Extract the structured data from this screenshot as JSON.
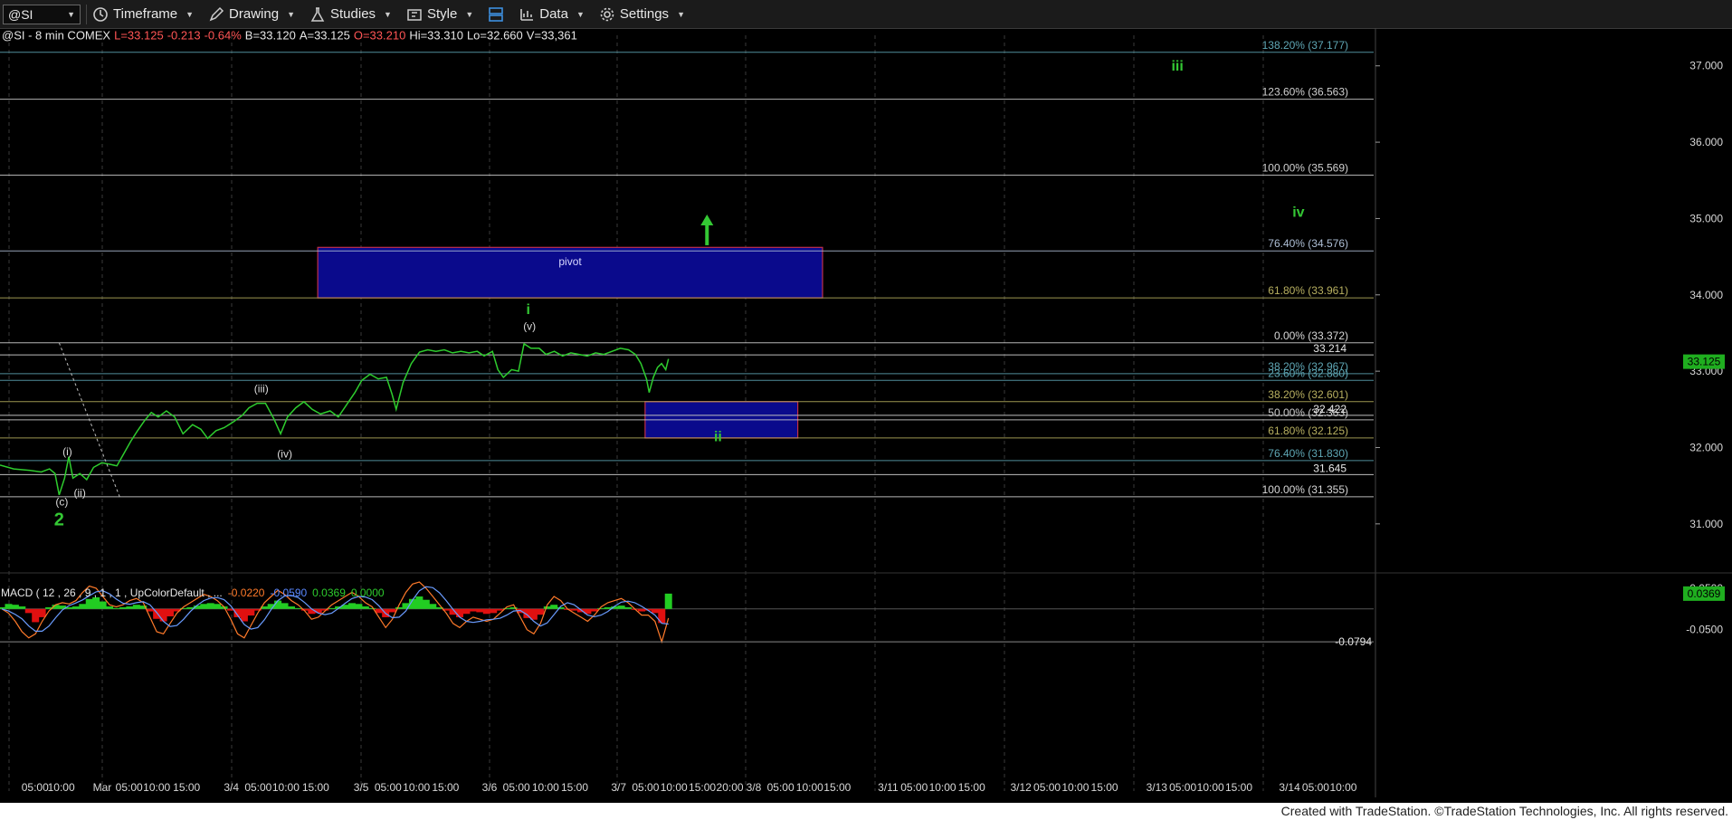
{
  "toolbar": {
    "symbol": "@SI",
    "timeframe": "Timeframe",
    "drawing": "Drawing",
    "studies": "Studies",
    "style": "Style",
    "data": "Data",
    "settings": "Settings"
  },
  "header": {
    "symbol_info": "@SI - 8 min  COMEX",
    "last": "L=33.125",
    "change": "-0.213",
    "change_pct": "-0.64%",
    "bid": "B=33.120",
    "ask": "A=33.125",
    "open": "O=33.210",
    "high": "Hi=33.310",
    "low": "Lo=32.660",
    "volume": "V=33,361"
  },
  "macd": {
    "label": "MACD ( 12 , 26 , 9 , 1 , 1 , UpColorDefault , ...",
    "v1": "-0.0220",
    "v2": "-0.0590",
    "v3": "0.0369",
    "v4": "0.0000",
    "axis_labels": [
      "0.0500",
      "-0.0500"
    ],
    "current_tag": "0.0369",
    "min_tag": "-0.0794"
  },
  "footer": "Created with TradeStation. ©TradeStation Technologies, Inc. All rights reserved.",
  "colors": {
    "price": "#2ecc2e",
    "box_fill": "#0a0a8c",
    "box_border": "#c0304a",
    "wave_green": "#34c834",
    "macd_pos": "#22cc22",
    "macd_neg": "#e01010"
  },
  "chart_data": {
    "type": "line",
    "y_range": [
      30.5,
      37.4
    ],
    "y_ticks": [
      31.0,
      32.0,
      33.0,
      34.0,
      35.0,
      36.0,
      37.0
    ],
    "y_tick_labels": [
      "31.000",
      "32.000",
      "33.000",
      "34.000",
      "35.000",
      "36.000",
      "37.000"
    ],
    "x_labels": [
      "05:00",
      "10:00",
      "Mar",
      "05:00",
      "10:00",
      "15:00",
      "3/4",
      "05:00",
      "10:00",
      "15:00",
      "3/5",
      "05:00",
      "10:00",
      "15:00",
      "3/6",
      "05:00",
      "10:00",
      "15:00",
      "3/7",
      "05:00",
      "10:00",
      "15:00",
      "20:00",
      "3/8",
      "05:00",
      "10:00",
      "15:00",
      "3/11",
      "05:00",
      "10:00",
      "15:00",
      "3/12",
      "05:00",
      "10:00",
      "15:00",
      "3/13",
      "05:00",
      "10:00",
      "15:00",
      "3/14",
      "05:00",
      "10:00"
    ],
    "price_series": [
      [
        0.0,
        31.77
      ],
      [
        0.01,
        31.72
      ],
      [
        0.022,
        31.7
      ],
      [
        0.03,
        31.68
      ],
      [
        0.036,
        31.72
      ],
      [
        0.04,
        31.66
      ],
      [
        0.043,
        31.38
      ],
      [
        0.047,
        31.6
      ],
      [
        0.05,
        31.88
      ],
      [
        0.053,
        31.6
      ],
      [
        0.058,
        31.66
      ],
      [
        0.063,
        31.58
      ],
      [
        0.068,
        31.74
      ],
      [
        0.074,
        31.8
      ],
      [
        0.08,
        31.78
      ],
      [
        0.085,
        31.76
      ],
      [
        0.09,
        31.92
      ],
      [
        0.095,
        32.08
      ],
      [
        0.1,
        32.22
      ],
      [
        0.105,
        32.35
      ],
      [
        0.11,
        32.46
      ],
      [
        0.115,
        32.4
      ],
      [
        0.121,
        32.48
      ],
      [
        0.127,
        32.4
      ],
      [
        0.133,
        32.18
      ],
      [
        0.14,
        32.3
      ],
      [
        0.146,
        32.24
      ],
      [
        0.151,
        32.12
      ],
      [
        0.157,
        32.22
      ],
      [
        0.163,
        32.26
      ],
      [
        0.17,
        32.34
      ],
      [
        0.176,
        32.42
      ],
      [
        0.181,
        32.52
      ],
      [
        0.187,
        32.58
      ],
      [
        0.193,
        32.58
      ],
      [
        0.199,
        32.38
      ],
      [
        0.204,
        32.18
      ],
      [
        0.209,
        32.4
      ],
      [
        0.215,
        32.52
      ],
      [
        0.221,
        32.6
      ],
      [
        0.227,
        32.5
      ],
      [
        0.233,
        32.44
      ],
      [
        0.24,
        32.48
      ],
      [
        0.246,
        32.4
      ],
      [
        0.252,
        32.56
      ],
      [
        0.258,
        32.72
      ],
      [
        0.263,
        32.88
      ],
      [
        0.269,
        32.96
      ],
      [
        0.275,
        32.9
      ],
      [
        0.281,
        32.92
      ],
      [
        0.285,
        32.7
      ],
      [
        0.288,
        32.5
      ],
      [
        0.293,
        32.85
      ],
      [
        0.299,
        33.1
      ],
      [
        0.305,
        33.25
      ],
      [
        0.311,
        33.28
      ],
      [
        0.317,
        33.26
      ],
      [
        0.323,
        33.28
      ],
      [
        0.329,
        33.24
      ],
      [
        0.335,
        33.26
      ],
      [
        0.341,
        33.24
      ],
      [
        0.347,
        33.26
      ],
      [
        0.352,
        33.2
      ],
      [
        0.358,
        33.26
      ],
      [
        0.362,
        33.02
      ],
      [
        0.366,
        32.92
      ],
      [
        0.372,
        33.02
      ],
      [
        0.377,
        33.0
      ],
      [
        0.381,
        33.36
      ],
      [
        0.386,
        33.3
      ],
      [
        0.392,
        33.3
      ],
      [
        0.397,
        33.22
      ],
      [
        0.403,
        33.26
      ],
      [
        0.409,
        33.2
      ],
      [
        0.415,
        33.24
      ],
      [
        0.421,
        33.22
      ],
      [
        0.427,
        33.2
      ],
      [
        0.433,
        33.24
      ],
      [
        0.439,
        33.22
      ],
      [
        0.445,
        33.26
      ],
      [
        0.451,
        33.3
      ],
      [
        0.457,
        33.28
      ],
      [
        0.462,
        33.22
      ],
      [
        0.466,
        33.1
      ],
      [
        0.47,
        32.9
      ],
      [
        0.472,
        32.72
      ],
      [
        0.475,
        32.92
      ],
      [
        0.478,
        33.05
      ],
      [
        0.481,
        33.1
      ],
      [
        0.484,
        33.02
      ],
      [
        0.486,
        33.16
      ]
    ],
    "fib_levels": [
      {
        "label": "138.20% (37.177)",
        "value": 37.177,
        "color": "#5fa7b5"
      },
      {
        "label": "123.60% (36.563)",
        "value": 36.563,
        "color": "#cfcfcf"
      },
      {
        "label": "100.00% (35.569)",
        "value": 35.569,
        "color": "#cfcfcf"
      },
      {
        "label": "76.40% (34.576)",
        "value": 34.576,
        "color": "#aebfd6"
      },
      {
        "label": "61.80% (33.961)",
        "value": 33.961,
        "color": "#b8b060"
      },
      {
        "label": "0.00% (33.372)",
        "value": 33.372,
        "color": "#d8d8d8"
      },
      {
        "label": "38.20% (32.967)",
        "value": 32.967,
        "color": "#5fa7b5"
      },
      {
        "label": "23.60% (32.880)",
        "value": 32.88,
        "color": "#5fa7b5"
      },
      {
        "label": "38.20% (32.601)",
        "value": 32.601,
        "color": "#b8b060"
      },
      {
        "label": "50.00% (32.363)",
        "value": 32.363,
        "color": "#cfcfcf"
      },
      {
        "label": "61.80% (32.125)",
        "value": 32.125,
        "color": "#b8b060"
      },
      {
        "label": "76.40% (31.830)",
        "value": 31.83,
        "color": "#5fa7b5"
      },
      {
        "label": "100.00% (31.355)",
        "value": 31.355,
        "color": "#d8d8d8"
      }
    ],
    "price_lines": [
      {
        "label": "33.214",
        "value": 33.214
      },
      {
        "label": "32.422",
        "value": 32.422
      },
      {
        "label": "31.645",
        "value": 31.645
      }
    ],
    "last_price": {
      "label": "33.125",
      "value": 33.125
    },
    "boxes": [
      {
        "label": "pivot",
        "x0": 0.231,
        "x1": 0.598,
        "y0": 33.961,
        "y1": 34.622
      },
      {
        "label": "ii",
        "x0": 0.469,
        "x1": 0.58,
        "y0": 32.125,
        "y1": 32.601
      }
    ],
    "wave_labels": [
      {
        "text": "2",
        "x": 0.043,
        "y": 30.98,
        "color": "green",
        "size": "large"
      },
      {
        "text": "(c)",
        "x": 0.045,
        "y": 31.24,
        "color": "white"
      },
      {
        "text": "(i)",
        "x": 0.049,
        "y": 31.9,
        "color": "white"
      },
      {
        "text": "(ii)",
        "x": 0.058,
        "y": 31.36,
        "color": "white"
      },
      {
        "text": "(iii)",
        "x": 0.19,
        "y": 32.72,
        "color": "white"
      },
      {
        "text": "(iv)",
        "x": 0.207,
        "y": 31.87,
        "color": "white"
      },
      {
        "text": "(v)",
        "x": 0.385,
        "y": 33.54,
        "color": "white"
      },
      {
        "text": "i",
        "x": 0.384,
        "y": 33.75,
        "color": "green"
      },
      {
        "text": "ii",
        "x": 0.522,
        "y": 32.08,
        "color": "green"
      },
      {
        "text": "iii",
        "x": 0.856,
        "y": 36.94,
        "color": "green"
      },
      {
        "text": "iv",
        "x": 0.944,
        "y": 35.02,
        "color": "green"
      }
    ],
    "macd_hist": [
      0.004,
      0.012,
      0.01,
      0.006,
      -0.01,
      -0.032,
      -0.02,
      0.004,
      0.01,
      0.008,
      0.004,
      0.006,
      0.012,
      0.024,
      0.028,
      0.018,
      0.006,
      0.002,
      0.004,
      0.006,
      0.01,
      0.008,
      -0.006,
      -0.024,
      -0.03,
      -0.018,
      -0.006,
      0.002,
      0.004,
      0.008,
      0.012,
      0.014,
      0.012,
      0.006,
      -0.004,
      -0.02,
      -0.03,
      -0.016,
      -0.004,
      0.006,
      0.012,
      0.02,
      0.014,
      0.006,
      0.002,
      -0.004,
      -0.012,
      -0.01,
      -0.004,
      0.002,
      0.006,
      0.01,
      0.014,
      0.012,
      0.006,
      0.002,
      -0.01,
      -0.02,
      -0.008,
      0.004,
      0.014,
      0.024,
      0.03,
      0.022,
      0.012,
      0.004,
      -0.004,
      -0.014,
      -0.02,
      -0.012,
      -0.006,
      -0.008,
      -0.012,
      -0.01,
      -0.004,
      0.002,
      0.004,
      -0.01,
      -0.022,
      -0.026,
      -0.014,
      0.006,
      0.01,
      0.004,
      -0.002,
      -0.004,
      -0.008,
      -0.012,
      -0.006,
      0.002,
      0.004,
      0.006,
      0.008,
      0.004,
      -0.002,
      -0.006,
      -0.004,
      -0.01,
      -0.034,
      0.0369
    ],
    "macd_line": [
      0.0,
      -0.01,
      -0.03,
      -0.055,
      -0.07,
      -0.06,
      -0.03,
      -0.005,
      0.01,
      0.015,
      0.012,
      0.02,
      0.04,
      0.055,
      0.05,
      0.03,
      0.01,
      0.005,
      0.01,
      0.02,
      0.025,
      0.015,
      -0.02,
      -0.055,
      -0.06,
      -0.035,
      -0.01,
      0.005,
      0.015,
      0.025,
      0.035,
      0.03,
      0.02,
      0.005,
      -0.025,
      -0.06,
      -0.07,
      -0.04,
      -0.01,
      0.015,
      0.03,
      0.045,
      0.035,
      0.02,
      0.01,
      -0.005,
      -0.025,
      -0.02,
      -0.005,
      0.01,
      0.02,
      0.03,
      0.04,
      0.03,
      0.015,
      0.005,
      -0.02,
      -0.045,
      -0.025,
      0.01,
      0.04,
      0.06,
      0.065,
      0.05,
      0.03,
      0.01,
      -0.01,
      -0.035,
      -0.045,
      -0.03,
      -0.02,
      -0.025,
      -0.03,
      -0.025,
      -0.01,
      0.005,
      0.01,
      -0.02,
      -0.05,
      -0.06,
      -0.035,
      0.01,
      0.03,
      0.02,
      0.0,
      -0.01,
      -0.02,
      -0.03,
      -0.015,
      0.005,
      0.015,
      0.02,
      0.025,
      0.015,
      0.0,
      -0.015,
      -0.015,
      -0.03,
      -0.0794,
      -0.022
    ],
    "macd_range": [
      -0.09,
      0.065
    ]
  }
}
